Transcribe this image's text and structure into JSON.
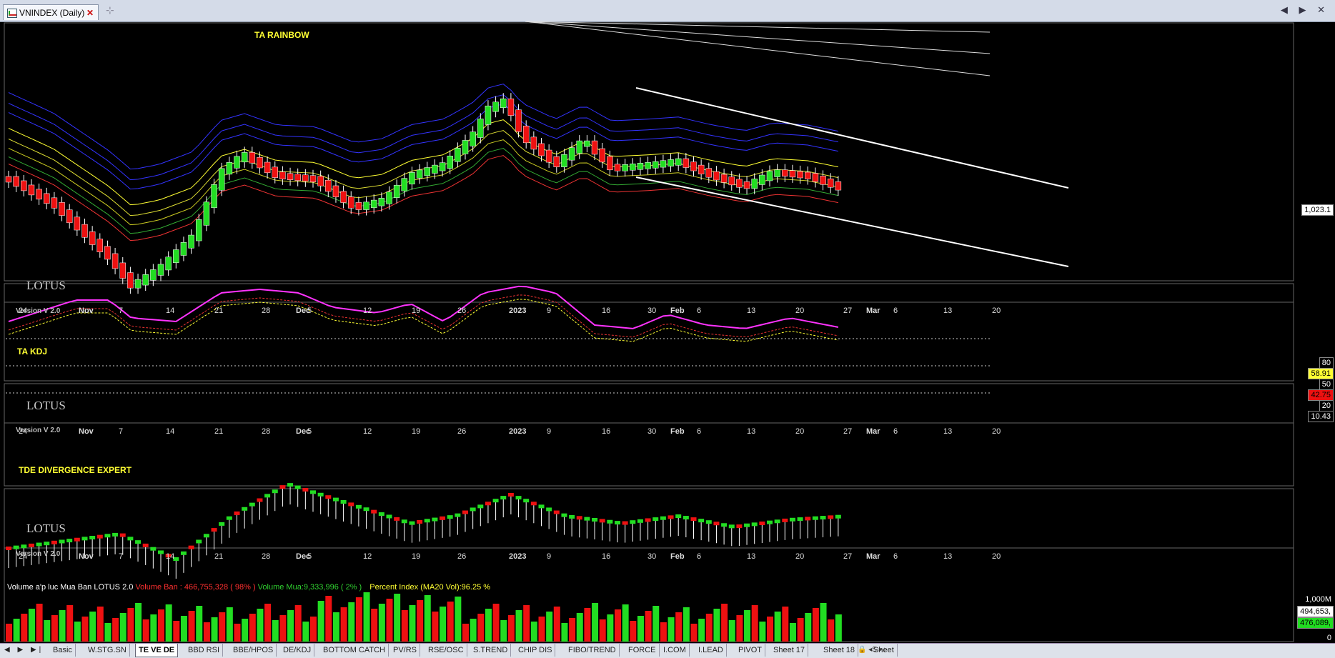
{
  "window": {
    "tab_title": "VNINDEX (Daily)",
    "close_glyph": "✕",
    "pin_glyph": "⊹",
    "nav_glyphs": "◀ ▶ ✕"
  },
  "panels": {
    "rainbow": {
      "title": "TA RAINBOW",
      "watermark": "LOTUS",
      "version": "Version V 2.0",
      "last_price": "1,023.1"
    },
    "kdj": {
      "title": "TA KDJ",
      "watermark": "LOTUS",
      "version": "Version V 2.0",
      "levels": [
        "80",
        "58.91",
        "50",
        "42.75",
        "20",
        "10.43"
      ]
    },
    "divergence": {
      "title": "TDE DIVERGENCE EXPERT",
      "watermark": "LOTUS",
      "version": "Version V 2.0"
    },
    "volume": {
      "title": "Volume a'p luc Mua Ban LOTUS 2.0",
      "ban": "Volume Ban : 466,755,328 ( 98% )",
      "mua": "Volume Mua:9,333,996 ( 2% )",
      "percent": "Percent Index (MA20 Vol):96.25 %",
      "scale": [
        "1,000M",
        "494,653,",
        "476,089,",
        "0"
      ]
    }
  },
  "date_axis": [
    {
      "text": "24",
      "bold": false
    },
    {
      "text": "Nov",
      "bold": true
    },
    {
      "text": "7",
      "bold": false
    },
    {
      "text": "14",
      "bold": false
    },
    {
      "text": "21",
      "bold": false
    },
    {
      "text": "28",
      "bold": false
    },
    {
      "text": "Dec",
      "bold": true
    },
    {
      "text": "5",
      "bold": false
    },
    {
      "text": "12",
      "bold": false
    },
    {
      "text": "19",
      "bold": false
    },
    {
      "text": "26",
      "bold": false
    },
    {
      "text": "2023",
      "bold": true
    },
    {
      "text": "9",
      "bold": false
    },
    {
      "text": "16",
      "bold": false
    },
    {
      "text": "30",
      "bold": false
    },
    {
      "text": "Feb",
      "bold": true
    },
    {
      "text": "6",
      "bold": false
    },
    {
      "text": "13",
      "bold": false
    },
    {
      "text": "20",
      "bold": false
    },
    {
      "text": "27",
      "bold": false
    },
    {
      "text": "Mar",
      "bold": true
    },
    {
      "text": "6",
      "bold": false
    },
    {
      "text": "13",
      "bold": false
    },
    {
      "text": "20",
      "bold": false
    }
  ],
  "sheet_nav": "◀ ▶ ▶|",
  "sheets": [
    "Basic",
    "W.STG.SN",
    "TE VE DE",
    "BBD RSI",
    "BBE/HPOS",
    "DE/KDJ",
    "BOTTOM CATCH",
    "PV/RS",
    "RSE/OSC",
    "S.TREND",
    "CHIP DIS",
    "FIBO/TREND",
    "FORCE",
    "I.COM",
    "I.LEAD",
    "PIVOT",
    "Sheet 17",
    "Sheet 18",
    "Sheet"
  ],
  "active_sheet": "TE VE DE",
  "sheet_extra": "🔒 ◂S ▸↓",
  "colors": {
    "up": "#22dd22",
    "down": "#ee1111",
    "kdj_k": "#ff33ff",
    "grid": "#555555"
  }
}
